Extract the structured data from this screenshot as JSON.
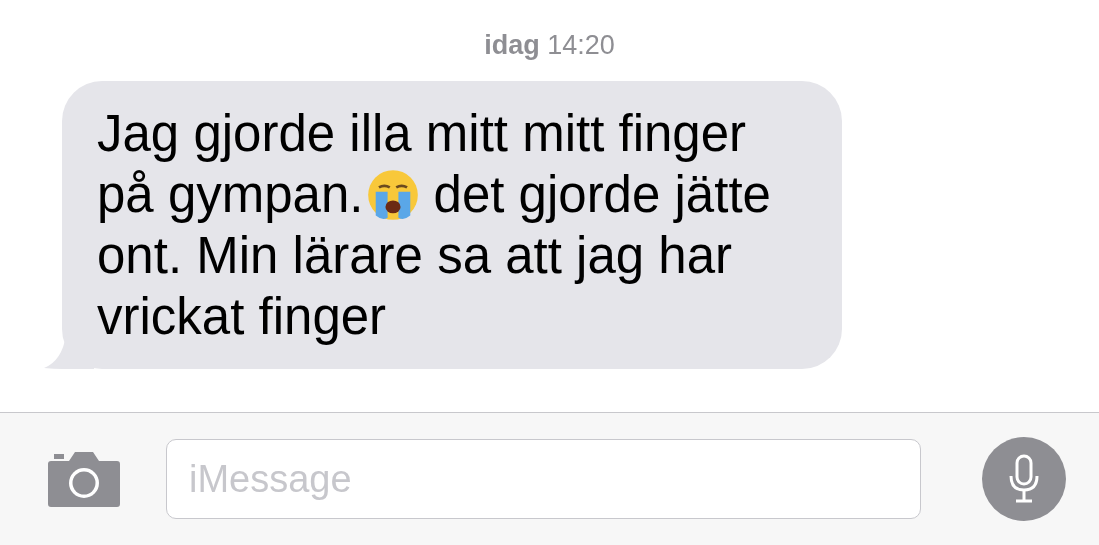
{
  "timestamp": {
    "day": "idag",
    "time": "14:20"
  },
  "messages": [
    {
      "kind": "incoming",
      "lines": [
        [
          {
            "kind": "text",
            "text": "Jag gjorde illa mitt mitt finger"
          }
        ],
        [
          {
            "kind": "text",
            "text": "på gympan."
          },
          {
            "kind": "emoji"
          },
          {
            "kind": "text",
            "text": "det gjorde jätte"
          }
        ],
        [
          {
            "kind": "text",
            "text": "ont. Min lärare sa att jag har"
          }
        ],
        [
          {
            "kind": "text",
            "text": "vrickat finger"
          }
        ]
      ]
    }
  ],
  "composer": {
    "placeholder": "iMessage"
  }
}
